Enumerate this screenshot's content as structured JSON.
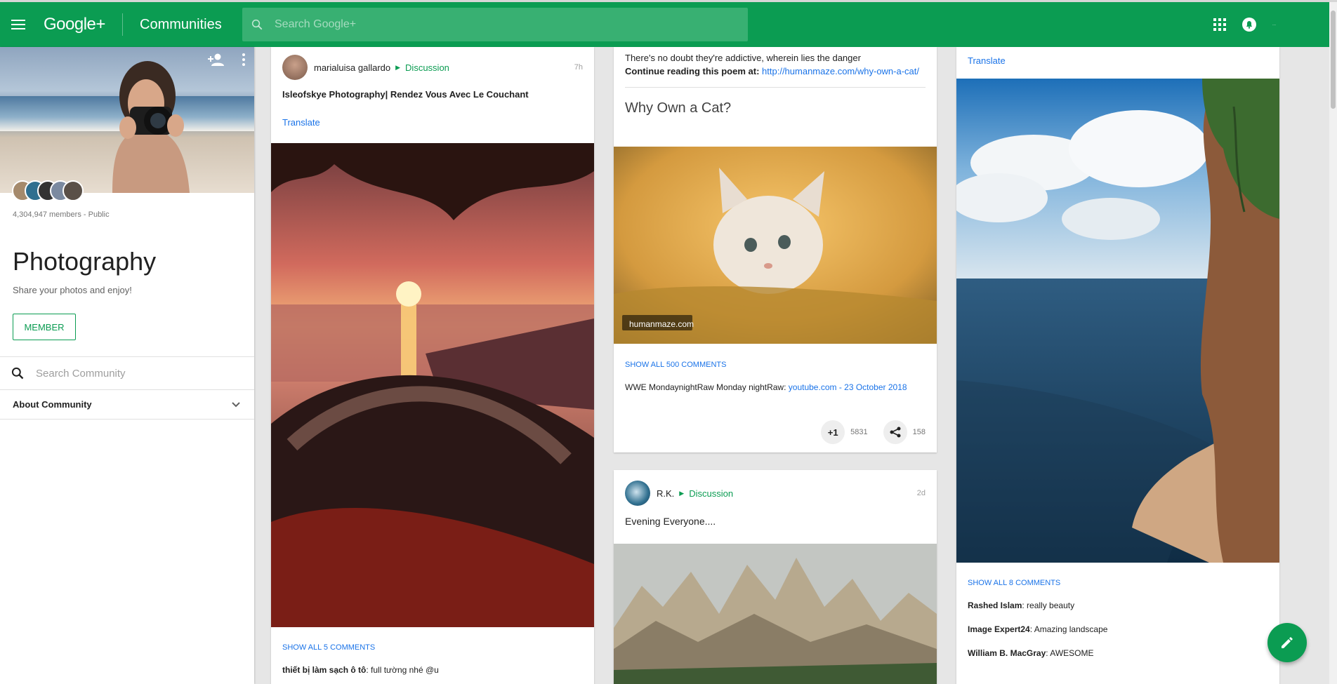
{
  "header": {
    "logo": "Google+",
    "section": "Communities",
    "search_placeholder": "Search Google+",
    "account_label": "..."
  },
  "community": {
    "members": "4,304,947 members - Public",
    "title": "Photography",
    "tagline": "Share your photos and enjoy!",
    "member_button": "MEMBER",
    "search_placeholder": "Search Community",
    "about": "About Community"
  },
  "post1": {
    "author": "marialuisa gallardo",
    "category": "Discussion",
    "time": "7h",
    "text": "Isleofskye  Photography|  Rendez Vous Avec Le Couchant",
    "translate": "Translate",
    "show_comments": "SHOW ALL 5 COMMENTS",
    "comment_author": "thiết bị làm sạch ô tô",
    "comment_text": ": full tường nhé @u"
  },
  "post2": {
    "line1": "There's no doubt they're addictive, wherein lies the danger",
    "continue_label": "Continue reading this poem at:",
    "continue_link": "http://humanmaze.com/why-own-a-cat/",
    "link_title": "Why Own a Cat?",
    "image_source": "humanmaze.com",
    "show_comments": "SHOW ALL 500 COMMENTS",
    "comment_author": "WWE MondaynightRaw Monday nightRaw",
    "comment_link": "youtube.com - 23 October 2018",
    "plus_label": "+1",
    "plus_count": "5831",
    "share_count": "158"
  },
  "post3": {
    "author": "R.K.",
    "category": "Discussion",
    "time": "2d",
    "text": "Evening Everyone...."
  },
  "post4": {
    "translate": "Translate",
    "show_comments": "SHOW ALL 8 COMMENTS",
    "comments": [
      {
        "author": "Rashed Islam",
        "text": ": really beauty"
      },
      {
        "author": "Image Expert24",
        "text": ": Amazing landscape"
      },
      {
        "author": "William B. MacGray",
        "text": ": AWESOME"
      }
    ]
  },
  "colors": {
    "brand_green": "#0b9c52",
    "link_blue": "#1a73e8"
  },
  "icons": [
    "menu-icon",
    "search-icon",
    "apps-grid-icon",
    "notifications-icon",
    "add-member-icon",
    "more-vert-icon",
    "chevron-down-icon",
    "share-icon",
    "edit-pencil-icon"
  ]
}
